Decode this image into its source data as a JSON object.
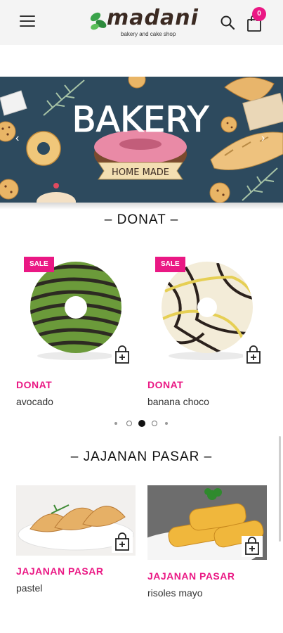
{
  "header": {
    "logo_text": "madani",
    "logo_subtitle": "bakery and cake shop",
    "cart_count": "0"
  },
  "banner": {
    "headline": "BAKERY",
    "ribbon": "HOME MADE"
  },
  "sections": [
    {
      "title": "– DONAT –",
      "products": [
        {
          "badge": "SALE",
          "category": "DONAT",
          "name": "avocado"
        },
        {
          "badge": "SALE",
          "category": "DONAT",
          "name": "banana choco"
        }
      ]
    },
    {
      "title": "– JAJANAN PASAR –",
      "products": [
        {
          "category": "JAJANAN PASAR",
          "name": "pastel"
        },
        {
          "category": "JAJANAN PASAR",
          "name": "risoles mayo"
        }
      ]
    }
  ],
  "carousel": {
    "dot_count": 5,
    "active_index": 2
  },
  "colors": {
    "accent": "#ea1884",
    "header_bg": "#f4f4f4",
    "banner_bg": "#2d4a5e"
  }
}
